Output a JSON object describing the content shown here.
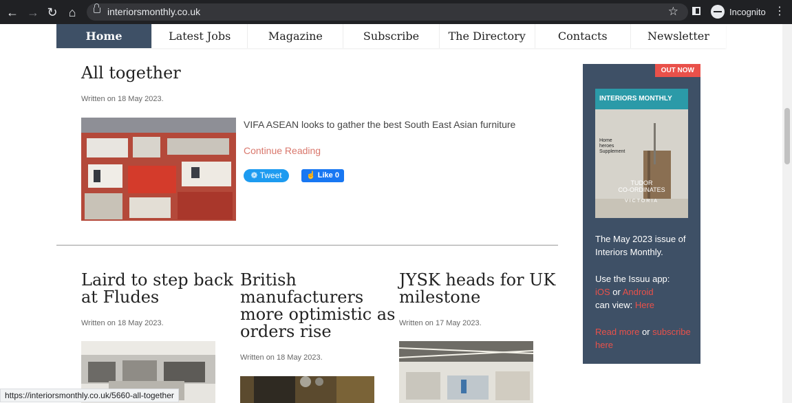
{
  "browser": {
    "url": "interiorsmonthly.co.uk",
    "incognito_label": "Incognito",
    "status_url": "https://interiorsmonthly.co.uk/5660-all-together"
  },
  "menu": [
    {
      "label": "Home",
      "active": true
    },
    {
      "label": "Latest Jobs"
    },
    {
      "label": "Magazine"
    },
    {
      "label": "Subscribe"
    },
    {
      "label": "The Directory"
    },
    {
      "label": "Contacts"
    },
    {
      "label": "Newsletter"
    }
  ],
  "featured": {
    "title": "All together",
    "meta": "Written on 18 May 2023.",
    "excerpt": "VIFA ASEAN looks to gather the best South East Asian furniture",
    "read_more": "Continue Reading",
    "tweet_label": "Tweet",
    "like_label": "Like 0"
  },
  "articles": [
    {
      "title_lines": [
        "Laird to step back",
        "at Fludes"
      ],
      "meta": "Written on 18 May 2023."
    },
    {
      "title_lines": [
        "British",
        "manufacturers",
        "more optimistic as",
        "orders rise"
      ],
      "meta": "Written on 18 May 2023."
    },
    {
      "title_lines": [
        "JYSK heads for UK",
        "milestone"
      ],
      "meta": "Written on 17 May 2023."
    }
  ],
  "sidebar": {
    "badge": "OUT NOW",
    "cover_masthead": "INTERIORS MONTHLY",
    "cover_lines": [
      "Home",
      "heroes",
      "Supplement"
    ],
    "cover_feature": "TUDOR\nCO-ORDINATES",
    "cover_brand": "VICTORIA",
    "issue_text": "The May 2023 issue of Interiors Monthly.",
    "app_text": "Use the Issuu app:",
    "ios": "iOS",
    "or": "or",
    "android": "Android",
    "can_view": "can view:",
    "here": "Here",
    "read_more": "Read more",
    "or2": "or",
    "subscribe_here": "subscribe here"
  },
  "colors": {
    "nav_active": "#3e5066",
    "accent": "#d9776c",
    "promo_bg": "#3e5066",
    "badge": "#e9514a"
  }
}
